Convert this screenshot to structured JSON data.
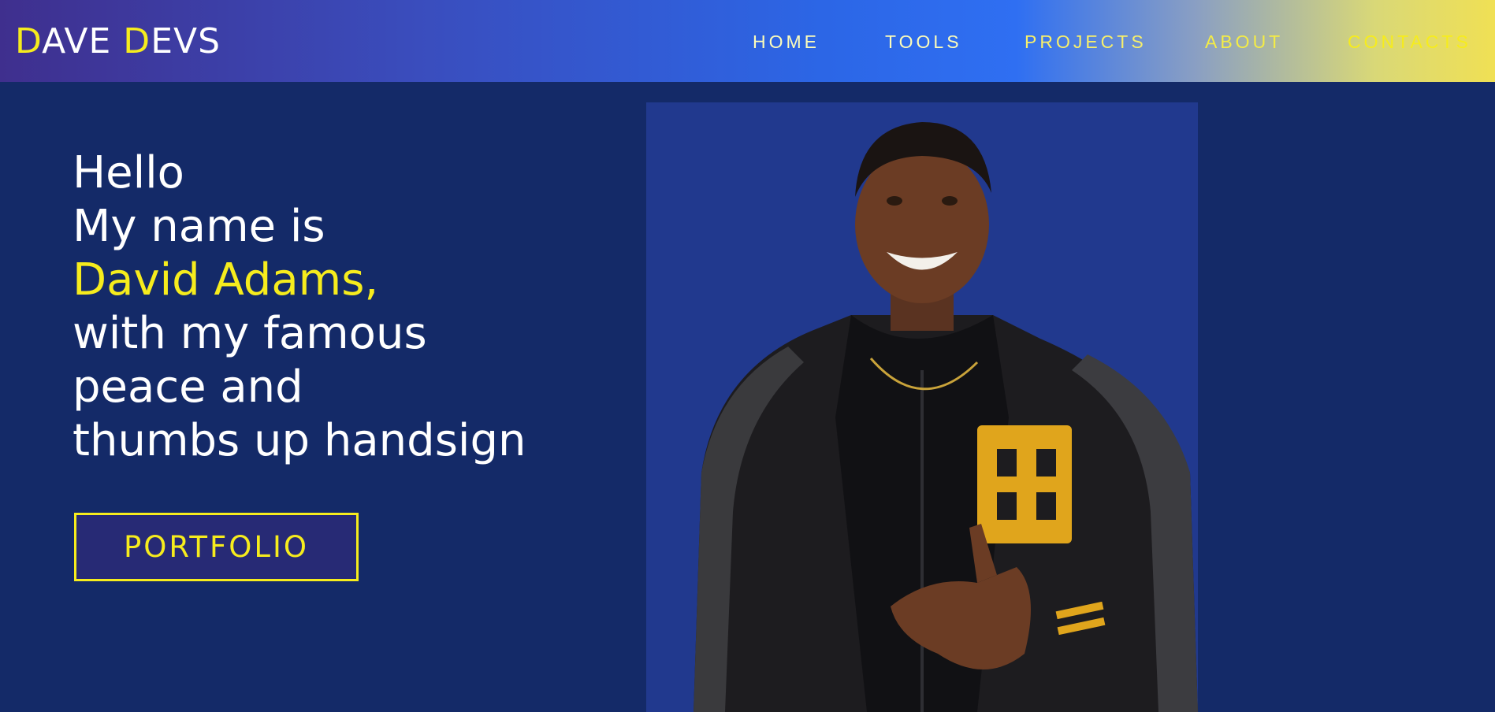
{
  "header": {
    "logo_first_initial": "D",
    "logo_first_rest": "AVE",
    "logo_second_initial": "D",
    "logo_second_rest": "EVS"
  },
  "nav": {
    "home": "HOME",
    "tools": "TOOLS",
    "projects": "PROJECTS",
    "about": "ABOUT",
    "contacts": "CONTACTS"
  },
  "hero": {
    "line1": "Hello",
    "line2": "My name is",
    "name": "David Adams,",
    "line4": "with my famous",
    "line5": "peace and",
    "line6": "thumbs up handsign",
    "cta_label": "PORTFOLIO"
  },
  "colors": {
    "background": "#142a68",
    "accent_yellow": "#f6ec1d",
    "photo_bg": "#21398e",
    "text_white": "#ffffff"
  }
}
